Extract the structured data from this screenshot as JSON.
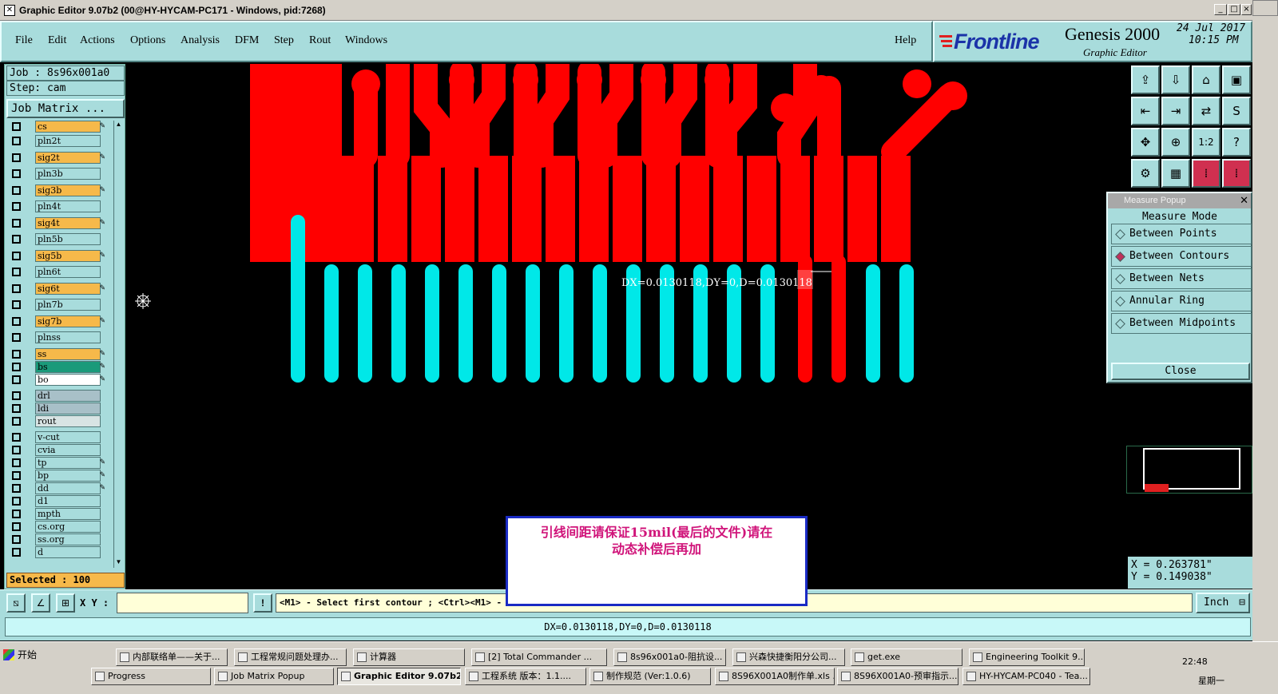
{
  "window": {
    "title": "Graphic Editor 9.07b2 (00@HY-HYCAM-PC171 - Windows, pid:7268)"
  },
  "menu": {
    "items": [
      "File",
      "Edit",
      "Actions",
      "Options",
      "Analysis",
      "DFM",
      "Step",
      "Rout",
      "Windows"
    ],
    "help": "Help"
  },
  "brand": {
    "logo": "Frontline",
    "product": "Genesis 2000",
    "subtitle": "Graphic Editor",
    "date": "24 Jul 2017",
    "time": "10:15 PM"
  },
  "job": {
    "job_line": "Job : 8s96x001a0",
    "step_line": "Step: cam",
    "matrix_button": "Job Matrix ..."
  },
  "layers": [
    {
      "name": "cs",
      "color": "#f6b94a",
      "mark": "✎"
    },
    {
      "name": "pln2t",
      "color": "#a8dcdc",
      "mark": ""
    },
    {
      "name": "sig2t",
      "color": "#f6b94a",
      "mark": "✎"
    },
    {
      "name": "pln3b",
      "color": "#a8dcdc",
      "mark": ""
    },
    {
      "name": "sig3b",
      "color": "#f6b94a",
      "mark": "✎"
    },
    {
      "name": "pln4t",
      "color": "#a8dcdc",
      "mark": ""
    },
    {
      "name": "sig4t",
      "color": "#f6b94a",
      "mark": "✎"
    },
    {
      "name": "pln5b",
      "color": "#a8dcdc",
      "mark": ""
    },
    {
      "name": "sig5b",
      "color": "#f6b94a",
      "mark": "✎"
    },
    {
      "name": "pln6t",
      "color": "#a8dcdc",
      "mark": ""
    },
    {
      "name": "sig6t",
      "color": "#f6b94a",
      "mark": "✎"
    },
    {
      "name": "pln7b",
      "color": "#a8dcdc",
      "mark": ""
    },
    {
      "name": "sig7b",
      "color": "#f6b94a",
      "mark": "✎"
    },
    {
      "name": "plnss",
      "color": "#a8dcdc",
      "mark": ""
    },
    {
      "name": "ss",
      "color": "#f6b94a",
      "mark": "✎"
    },
    {
      "name": "bs",
      "color": "#1a9a7a",
      "mark": "✎"
    },
    {
      "name": "bo",
      "color": "#ffffff",
      "mark": "✎"
    },
    {
      "name": "drl",
      "color": "#a8c0c8",
      "mark": ""
    },
    {
      "name": "ldi",
      "color": "#a8c0c8",
      "mark": ""
    },
    {
      "name": "rout",
      "color": "#d8e4e4",
      "mark": ""
    },
    {
      "name": "v-cut",
      "color": "#a8dcdc",
      "mark": ""
    },
    {
      "name": "cvia",
      "color": "#a8dcdc",
      "mark": ""
    },
    {
      "name": "tp",
      "color": "#a8dcdc",
      "mark": "✎"
    },
    {
      "name": "bp",
      "color": "#a8dcdc",
      "mark": "✎"
    },
    {
      "name": "dd",
      "color": "#a8dcdc",
      "mark": "✎"
    },
    {
      "name": "d1",
      "color": "#a8dcdc",
      "mark": ""
    },
    {
      "name": "mpth",
      "color": "#a8dcdc",
      "mark": ""
    },
    {
      "name": "cs.org",
      "color": "#a8dcdc",
      "mark": ""
    },
    {
      "name": "ss.org",
      "color": "#a8dcdc",
      "mark": ""
    },
    {
      "name": "d",
      "color": "#a8dcdc",
      "mark": ""
    }
  ],
  "selected": "Selected : 100",
  "canvas": {
    "measure_label": "DX=0.0130118,DY=0,D=0.0130118"
  },
  "measure_popup": {
    "title": "Measure Popup",
    "heading": "Measure Mode",
    "options": [
      "Between Points",
      "Between Contours",
      "Between Nets",
      "Annular Ring",
      "Between Midpoints"
    ],
    "selected_option": "Between Contours",
    "close": "Close"
  },
  "coords": {
    "x": "X  =  0.263781\"",
    "y": "Y  =  0.149038\""
  },
  "command": {
    "xy_label": "X Y :",
    "xy_value": "",
    "prompt": "<M1> - Select first contour ; <Ctrl><M1> - ",
    "units": "Inch"
  },
  "status": {
    "text": "DX=0.0130118,DY=0,D=0.0130118"
  },
  "note": {
    "line1": "引线间距请保证15mil(最后的文件)请在",
    "line2": "动态补偿后再加"
  },
  "taskbar": {
    "start": "开始",
    "row1": [
      "内部联络单——关于...",
      "工程常规问题处理办...",
      "计算器",
      "[2] Total Commander ...",
      "8s96x001a0-阻抗设...",
      "兴森快捷衡阳分公司...",
      "get.exe",
      "Engineering Toolkit 9...."
    ],
    "row2": [
      "Progress",
      "Job Matrix Popup",
      "Graphic Editor 9.07b2...",
      "工程系统  版本：1.1....",
      "制作规范 (Ver:1.0.6)",
      "8S96X001A0制作单.xls ...",
      "8S96X001A0-预审指示...",
      "HY-HYCAM-PC040 - Tea..."
    ],
    "active": "Graphic Editor 9.07b2...",
    "time": "22:48",
    "day": "星期一"
  },
  "colors": {
    "panel": "#a8dcdc",
    "copper_red": "#ff0000",
    "trace_cyan": "#00e8e8",
    "canvas": "#000000",
    "note_text": "#d0147a",
    "note_border": "#1a2bc4"
  }
}
